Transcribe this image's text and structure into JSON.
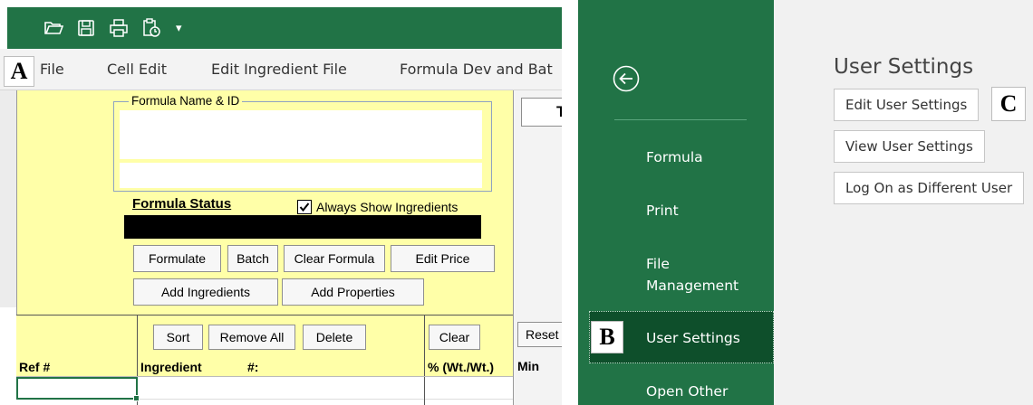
{
  "quick_access": {
    "icons": [
      "open-folder-icon",
      "save-icon",
      "print-icon",
      "clipboard-clock-icon"
    ],
    "dropdown_glyph": "▾"
  },
  "markers": {
    "a": "A",
    "b": "B",
    "c": "C"
  },
  "menu": {
    "file": "File",
    "cell_edit": "Cell Edit",
    "edit_ingredient_file": "Edit Ingredient File",
    "formula_dev": "Formula Dev and Bat"
  },
  "form": {
    "legend": "Formula Name & ID",
    "status_label": "Formula Status",
    "always_show_label": "Always Show Ingredients",
    "always_show_checked": true,
    "right_box_text": "T",
    "right_tick": "-"
  },
  "buttons": {
    "formulate": "Formulate",
    "batch": "Batch",
    "clear_formula": "Clear Formula",
    "edit_price": "Edit Price",
    "add_ingredients": "Add Ingredients",
    "add_properties": "Add Properties",
    "sort": "Sort",
    "remove_all": "Remove All",
    "delete": "Delete",
    "clear": "Clear",
    "reset": "Reset"
  },
  "grid": {
    "headers": {
      "ref": "Ref #",
      "ingredient": "Ingredient",
      "number": "#:",
      "pct": "% (Wt./Wt.)",
      "min": "Min"
    }
  },
  "backstage": {
    "nav": [
      "Formula",
      "Print",
      "File\nManagement",
      "User Settings",
      "Open Other"
    ],
    "selected": "User Settings"
  },
  "user_settings": {
    "title": "User Settings",
    "buttons": [
      "Edit User Settings",
      "View User Settings",
      "Log On as Different User"
    ]
  },
  "colors": {
    "excel_green": "#217346",
    "selected_green": "#0e4f2b",
    "form_yellow": "#ffffa8"
  }
}
